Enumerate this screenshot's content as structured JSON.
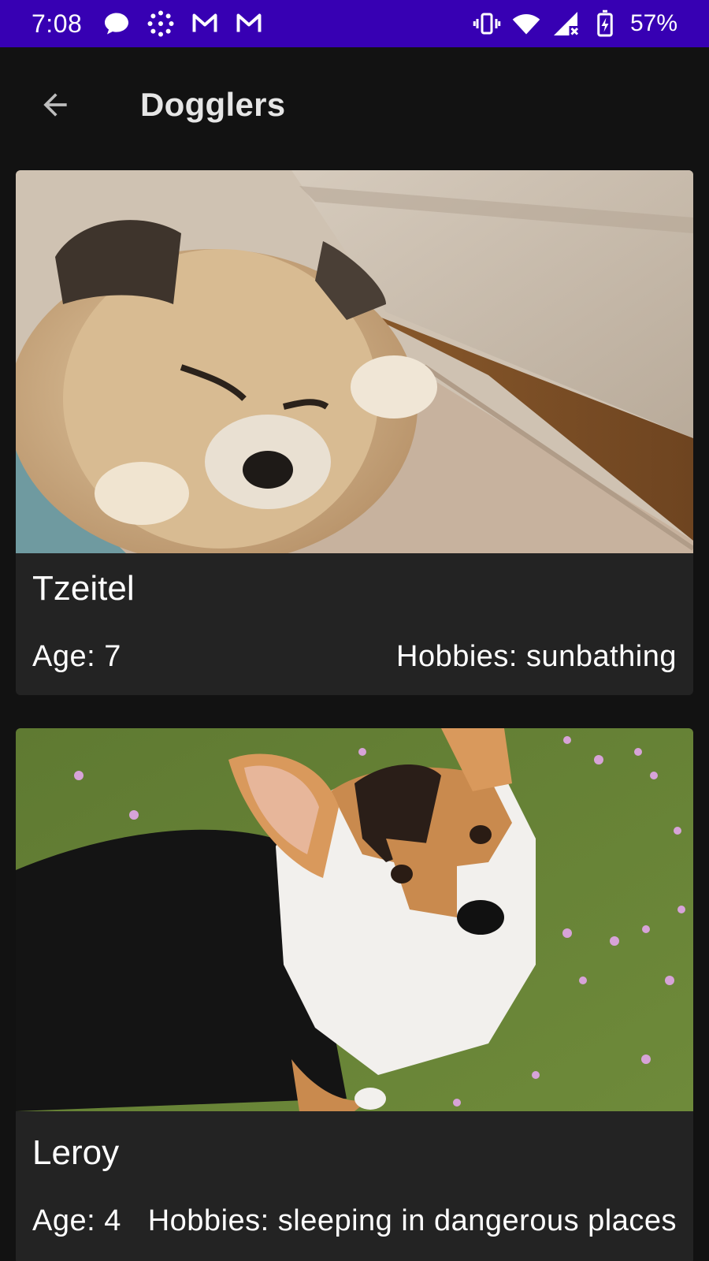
{
  "status_bar": {
    "time": "7:08",
    "battery_percent": "57%",
    "left_icons": [
      "chat-bubble-icon",
      "loading-ring-icon",
      "gmail-icon",
      "gmail-icon"
    ],
    "right_icons": [
      "vibrate-icon",
      "wifi-icon",
      "signal-icon",
      "battery-charging-icon"
    ],
    "background_color": "#3700b3"
  },
  "app_bar": {
    "title": "Dogglers",
    "back_icon": "arrow-back-icon"
  },
  "dogs": [
    {
      "name": "Tzeitel",
      "age": "Age: 7",
      "hobbies": "Hobbies: sunbathing"
    },
    {
      "name": "Leroy",
      "age": "Age: 4",
      "hobbies": "Hobbies: sleeping in dangerous places"
    }
  ],
  "colors": {
    "background": "#121212",
    "card": "#232323",
    "text": "#ffffff"
  }
}
